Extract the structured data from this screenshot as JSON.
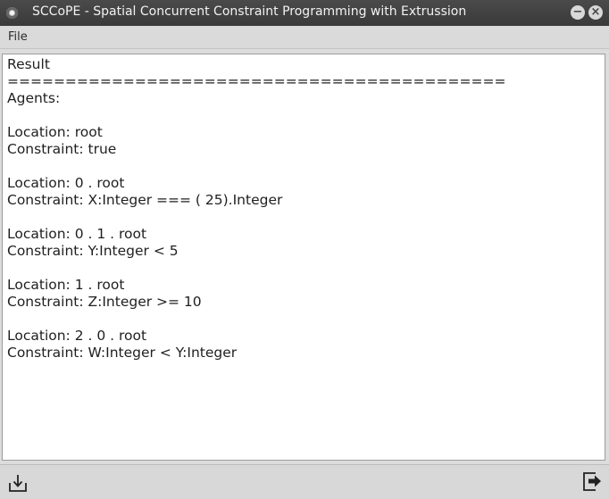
{
  "window": {
    "title": "SCCoPE - Spatial Concurrent Constraint Programming with Extrussion",
    "minimize_glyph": "−",
    "close_glyph": "×"
  },
  "menu": {
    "file_label": "File"
  },
  "result": {
    "lines": [
      "Result",
      "===========================================",
      "Agents:",
      "",
      "Location: root",
      "Constraint: true",
      "",
      "Location: 0 . root",
      "Constraint: X:Integer === ( 25).Integer",
      "",
      "Location: 0 . 1 . root",
      "Constraint: Y:Integer < 5",
      "",
      "Location: 1 . root",
      "Constraint: Z:Integer >= 10",
      "",
      "Location: 2 . 0 . root",
      "Constraint: W:Integer < Y:Integer"
    ]
  },
  "toolbar": {
    "left_icon": "import-icon",
    "right_icon": "exit-icon"
  }
}
